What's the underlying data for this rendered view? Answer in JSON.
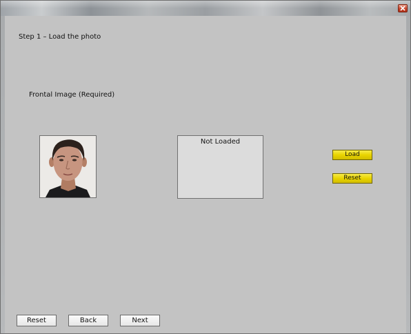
{
  "window": {
    "close_icon": "close-icon"
  },
  "step": {
    "title": "Step 1 – Load the photo"
  },
  "frontal": {
    "label": "Frontal Image (Required)",
    "photo_icon": "face-photo"
  },
  "preview": {
    "status_text": "Not Loaded"
  },
  "actions": {
    "load_label": "Load",
    "reset_label": "Reset"
  },
  "footer": {
    "reset_label": "Reset",
    "back_label": "Back",
    "next_label": "Next"
  },
  "colors": {
    "background": "#c3c3c3",
    "accent_button": "#e9d400",
    "close_button": "#c9452b"
  }
}
